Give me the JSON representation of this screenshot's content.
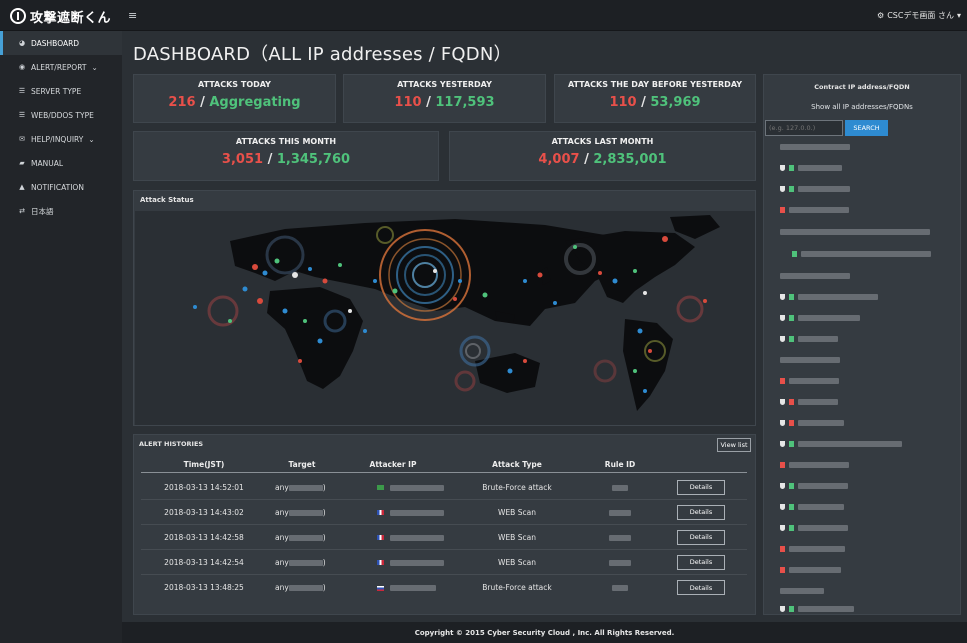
{
  "app": {
    "logo_text": "攻撃遮断くん",
    "menu_icon": "hamburger-icon"
  },
  "user": {
    "label": "CSCデモ画面 さん",
    "icon": "gear-icon"
  },
  "sidebar": {
    "items": [
      {
        "label": "DASHBOARD",
        "icon": "dashboard-icon",
        "active": true
      },
      {
        "label": "ALERT/REPORT",
        "icon": "eye-icon",
        "chevron": "⌄"
      },
      {
        "label": "SERVER TYPE",
        "icon": "list-icon"
      },
      {
        "label": "WEB/DDOS TYPE",
        "icon": "list-icon"
      },
      {
        "label": "HELP/INQUIRY",
        "icon": "envelope-icon",
        "chevron": "⌄"
      },
      {
        "label": "MANUAL",
        "icon": "book-icon"
      },
      {
        "label": "NOTIFICATION",
        "icon": "bell-icon"
      },
      {
        "label": "日本語",
        "icon": "exchange-icon"
      }
    ]
  },
  "page": {
    "title": "DASHBOARD（ALL IP addresses / FQDN）"
  },
  "stats": {
    "today": {
      "title": "ATTACKS TODAY",
      "red": "216",
      "green": "Aggregating"
    },
    "yesterday": {
      "title": "ATTACKS YESTERDAY",
      "red": "110",
      "green": "117,593"
    },
    "day_before": {
      "title": "ATTACKS THE DAY BEFORE YESTERDAY",
      "red": "110",
      "green": "53,969"
    },
    "this_month": {
      "title": "ATTACKS THIS MONTH",
      "red": "3,051",
      "green": "1,345,760"
    },
    "last_month": {
      "title": "ATTACKS LAST MONTH",
      "red": "4,007",
      "green": "2,835,001"
    },
    "separator": "/"
  },
  "attack_status": {
    "title": "Attack Status"
  },
  "alerts": {
    "title": "ALERT HISTORIES",
    "view_list": "View list",
    "columns": [
      "Time(JST)",
      "Target",
      "Attacker IP",
      "Attack Type",
      "Rule ID"
    ],
    "rows": [
      {
        "time": "2018-03-13 14:52:01",
        "target": "any",
        "type": "Brute-Force attack",
        "flag_color": "#3c9a4a"
      },
      {
        "time": "2018-03-13 14:43:02",
        "target": "any",
        "type": "WEB Scan",
        "flag_color": "#2d52b5"
      },
      {
        "time": "2018-03-13 14:42:58",
        "target": "any",
        "type": "WEB Scan",
        "flag_color": "#2d52b5"
      },
      {
        "time": "2018-03-13 14:42:54",
        "target": "any",
        "type": "WEB Scan",
        "flag_color": "#2d52b5"
      },
      {
        "time": "2018-03-13 13:48:25",
        "target": "any",
        "type": "Brute-Force attack",
        "flag_color": "#c9283b"
      }
    ],
    "details_label": "Details",
    "target_suffix": ")"
  },
  "contract": {
    "title": "Contract IP address/FQDN",
    "show_all": "Show all IP addresses/FQDNs",
    "placeholder": "(e.g. 127.0.0.)",
    "search_label": "SEARCH"
  },
  "colors": {
    "red": "#e8504a",
    "green": "#4fc27b",
    "accent": "#2e8bd1"
  },
  "footer": {
    "text": "Copyright © 2015 Cyber Security Cloud , Inc. All Rights Reserved."
  }
}
